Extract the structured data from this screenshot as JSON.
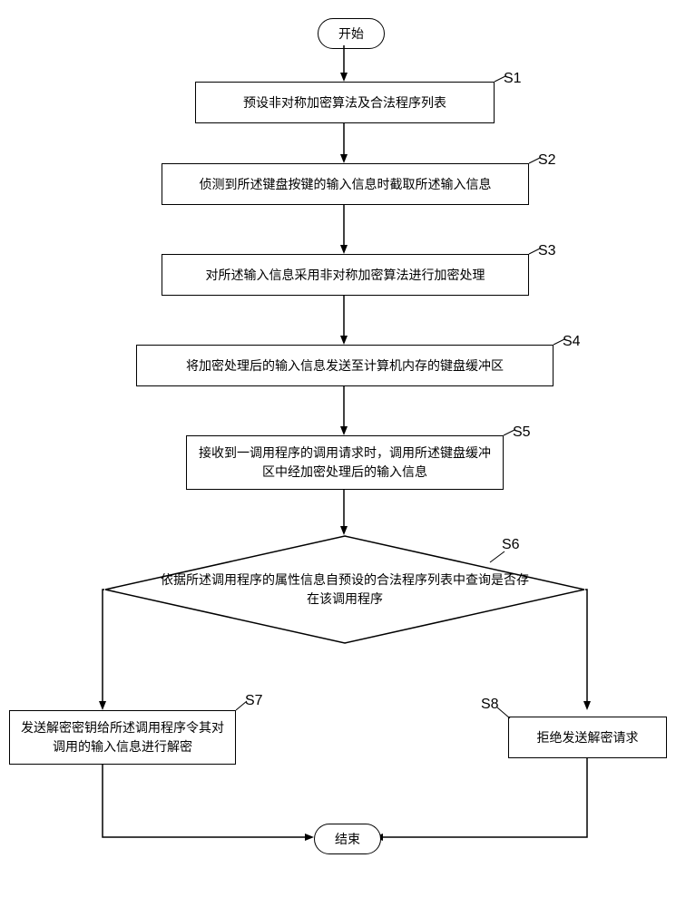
{
  "flowchart": {
    "start": "开始",
    "end": "结束",
    "steps": {
      "s1": {
        "label": "S1",
        "text": "预设非对称加密算法及合法程序列表"
      },
      "s2": {
        "label": "S2",
        "text": "侦测到所述键盘按键的输入信息时截取所述输入信息"
      },
      "s3": {
        "label": "S3",
        "text": "对所述输入信息采用非对称加密算法进行加密处理"
      },
      "s4": {
        "label": "S4",
        "text": "将加密处理后的输入信息发送至计算机内存的键盘缓冲区"
      },
      "s5": {
        "label": "S5",
        "text": "接收到一调用程序的调用请求时，调用所述键盘缓冲区中经加密处理后的输入信息"
      },
      "s6": {
        "label": "S6",
        "text": "依据所述调用程序的属性信息自预设的合法程序列表中查询是否存在该调用程序"
      },
      "s7": {
        "label": "S7",
        "text": "发送解密密钥给所述调用程序令其对调用的输入信息进行解密"
      },
      "s8": {
        "label": "S8",
        "text": "拒绝发送解密请求"
      }
    }
  }
}
